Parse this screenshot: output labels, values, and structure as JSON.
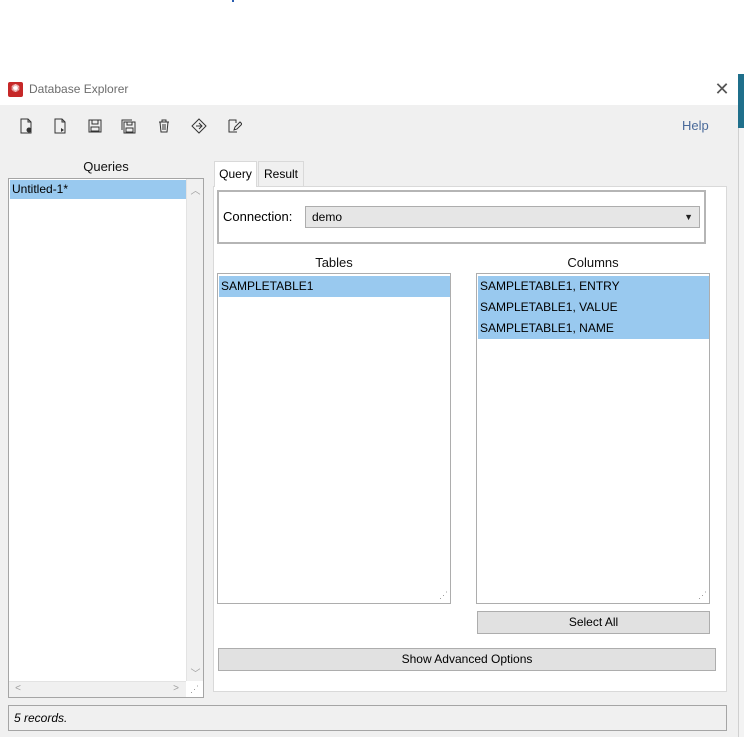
{
  "window": {
    "title": "Database Explorer",
    "close_glyph": "✕"
  },
  "toolbar": {
    "icons": [
      "new-query-icon",
      "open-query-icon",
      "save-icon",
      "save-all-icon",
      "delete-icon",
      "execute-icon",
      "edit-icon"
    ],
    "help_label": "Help"
  },
  "queries": {
    "heading": "Queries",
    "items": [
      {
        "label": "Untitled-1*",
        "selected": true
      }
    ]
  },
  "tabs": [
    {
      "label": "Query",
      "active": true
    },
    {
      "label": "Result",
      "active": false
    }
  ],
  "connection": {
    "label": "Connection:",
    "value": "demo"
  },
  "tables": {
    "heading": "Tables",
    "items": [
      {
        "label": "SAMPLETABLE1",
        "selected": true
      }
    ]
  },
  "columns": {
    "heading": "Columns",
    "items": [
      {
        "label": "SAMPLETABLE1, ENTRY",
        "selected": true
      },
      {
        "label": "SAMPLETABLE1, VALUE",
        "selected": true
      },
      {
        "label": "SAMPLETABLE1, NAME",
        "selected": true
      }
    ]
  },
  "buttons": {
    "select_all": "Select All",
    "show_advanced": "Show Advanced Options"
  },
  "status": {
    "text": "5 records."
  },
  "colors": {
    "selection": "#99c9ef",
    "help_link": "#4a6a9a",
    "app_icon": "#c62828"
  }
}
